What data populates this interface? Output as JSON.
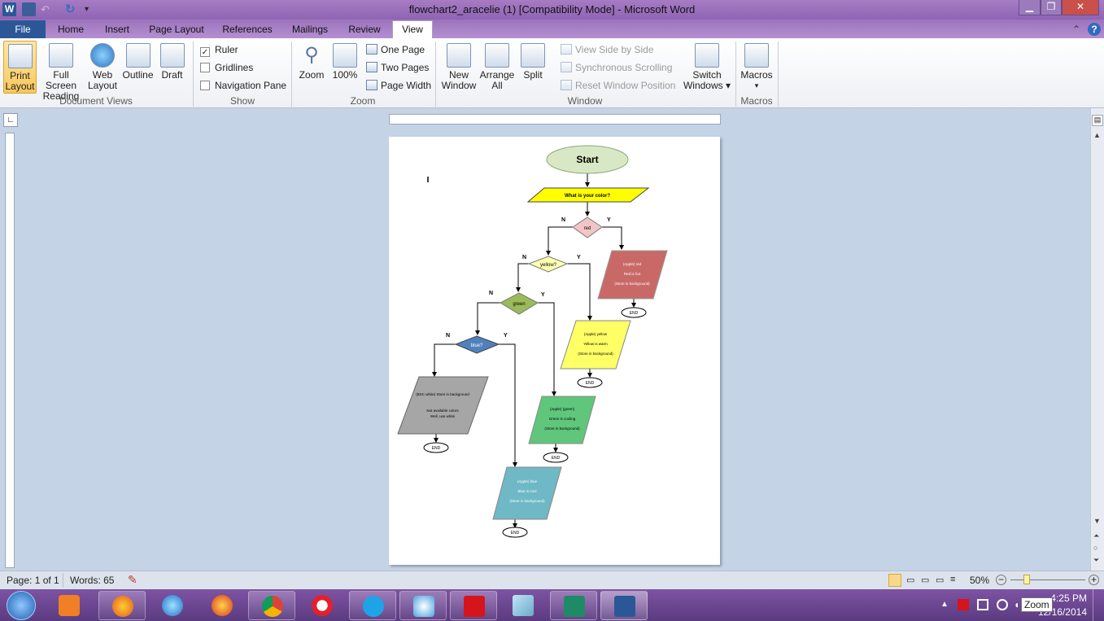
{
  "window": {
    "title": "flowchart2_aracelie (1) [Compatibility Mode] - Microsoft Word"
  },
  "tabs": [
    "File",
    "Home",
    "Insert",
    "Page Layout",
    "References",
    "Mailings",
    "Review",
    "View"
  ],
  "ribbon": {
    "document_views": {
      "group": "Document Views",
      "print_layout": [
        "Print",
        "Layout"
      ],
      "full_screen": [
        "Full Screen",
        "Reading"
      ],
      "web_layout": [
        "Web",
        "Layout"
      ],
      "outline": "Outline",
      "draft": "Draft"
    },
    "show": {
      "group": "Show",
      "ruler": "Ruler",
      "gridlines": "Gridlines",
      "navigation_pane": "Navigation Pane"
    },
    "zoom": {
      "group": "Zoom",
      "zoom": "Zoom",
      "hundred": "100%",
      "one_page": "One Page",
      "two_pages": "Two Pages",
      "page_width": "Page Width"
    },
    "window": {
      "group": "Window",
      "new_window": [
        "New",
        "Window"
      ],
      "arrange_all": [
        "Arrange",
        "All"
      ],
      "split": "Split",
      "side_by_side": "View Side by Side",
      "sync_scroll": "Synchronous Scrolling",
      "reset_pos": "Reset Window Position",
      "switch_windows": [
        "Switch",
        "Windows ▾"
      ]
    },
    "macros": {
      "group": "Macros",
      "macros": "Macros"
    }
  },
  "flowchart": {
    "start": "Start",
    "question": "What is your color?",
    "red_q": "red",
    "yellow_q": "yellow?",
    "green_q": "green",
    "blue_q": "blue?",
    "n": "N",
    "y": "Y",
    "end": "END",
    "red_box": [
      "(Apple) red",
      "Red is hot",
      "(Store in background)"
    ],
    "yellow_box": [
      "(Apple) yellow",
      "Yellow is warm",
      "(Store in background)"
    ],
    "green_box": [
      "(Apple) (green)",
      "Green is cooling",
      "(Store in background)"
    ],
    "blue_box": [
      "(Apple) blue",
      "Blue is cool",
      "(Store in background)"
    ],
    "gray_box": [
      "(BSC white) Store in background",
      "Not available colors",
      "Well, use white"
    ]
  },
  "status": {
    "page": "Page: 1 of 1",
    "words": "Words: 65",
    "zoom": "50%"
  },
  "taskbar": {
    "time": "4:25 PM",
    "date": "12/16/2014",
    "tooltip": "Zoom"
  }
}
